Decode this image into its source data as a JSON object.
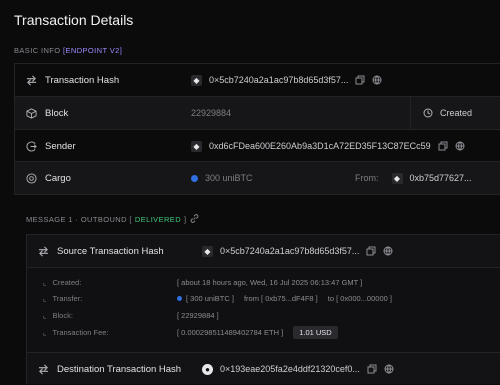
{
  "page": {
    "title": "Transaction Details"
  },
  "basic_info": {
    "label": "BASIC INFO",
    "endpoint": "[ENDPOINT V2]"
  },
  "rows": {
    "tx_hash": {
      "label": "Transaction Hash",
      "value": "0×5cb7240a2a1ac97b8d65d3f57..."
    },
    "block": {
      "label": "Block",
      "value": "22929884",
      "right_label": "Created"
    },
    "sender": {
      "label": "Sender",
      "value": "0xd6cFDea600E260Ab9a3D1cA72ED35F13C87ECc59"
    },
    "cargo": {
      "label": "Cargo",
      "value": "300 uniBTC",
      "from_label": "From:",
      "from_value": "0xb75d77627..."
    }
  },
  "message": {
    "prefix": "MESSAGE 1 · OUTBOUND [",
    "status": "DELIVERED",
    "suffix": "]"
  },
  "source": {
    "label": "Source Transaction Hash",
    "value": "0×5cb7240a2a1ac97b8d65d3f57...",
    "created_label": "Created:",
    "created_value": "[ about 18 hours ago, Wed, 16 Jul 2025 06:13:47 GMT ]",
    "transfer_label": "Transfer:",
    "transfer_amount": "[ 300 uniBTC ]",
    "transfer_from": "from [ 0xb75...dF4F8 ]",
    "transfer_to": "to [ 0x000...00000 ]",
    "block_label": "Block:",
    "block_value": "[ 22929884 ]",
    "fee_label": "Transaction Fee:",
    "fee_value": "[ 0.000298511489402784 ETH ]",
    "fee_usd": "1.01 USD"
  },
  "destination": {
    "label": "Destination Transaction Hash",
    "value": "0×193eae205fa2e4ddf21320cef0..."
  }
}
